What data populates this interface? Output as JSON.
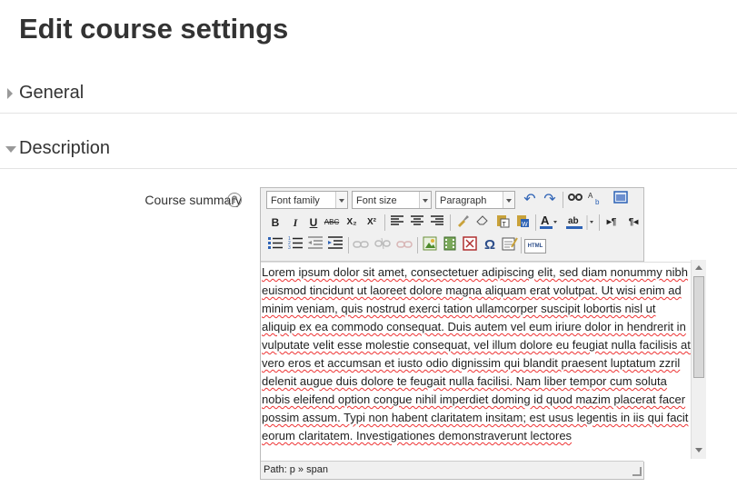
{
  "page": {
    "title": "Edit course settings"
  },
  "sections": [
    {
      "label": "General",
      "state": "collapsed"
    },
    {
      "label": "Description",
      "state": "expanded"
    }
  ],
  "field": {
    "label": "Course summary",
    "help_icon": "help-icon"
  },
  "toolbar": {
    "font_family": "Font family",
    "font_size": "Font size",
    "format": "Paragraph",
    "buttons": {
      "bold": "B",
      "italic": "I",
      "underline": "U",
      "strike": "ABC",
      "subscript": "X₂",
      "superscript": "X²",
      "omega": "Ω",
      "html": "HTML",
      "undo": "↶",
      "redo": "↷"
    }
  },
  "editor": {
    "text": "Lorem ipsum dolor sit amet, consectetuer adipiscing elit, sed diam nonummy nibh euismod tincidunt ut laoreet dolore magna aliquam erat volutpat. Ut wisi enim ad minim veniam, quis nostrud exerci tation ullamcorper suscipit lobortis nisl ut aliquip ex ea commodo consequat. Duis autem vel eum iriure dolor in hendrerit in vulputate velit esse molestie consequat, vel illum dolore eu feugiat nulla facilisis at vero eros et accumsan et iusto odio dignissim qui blandit praesent luptatum zzril delenit augue duis dolore te feugait nulla facilisi. Nam liber tempor cum soluta nobis eleifend option congue nihil imperdiet doming id quod mazim placerat facer possim assum. Typi non habent claritatem insitam; est usus legentis in iis qui facit eorum claritatem. Investigationes demonstraverunt lectores",
    "path": "Path: p » span"
  }
}
